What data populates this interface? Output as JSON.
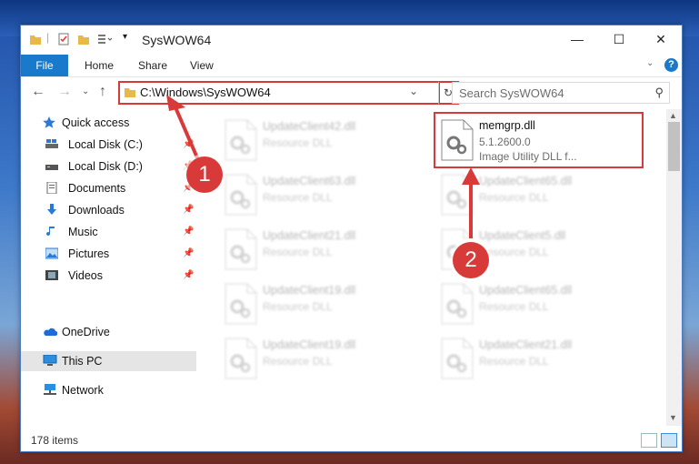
{
  "window": {
    "title": "SysWOW64",
    "controls": {
      "minimize": "—",
      "maximize": "☐",
      "close": "✕"
    }
  },
  "ribbon": {
    "tabs": [
      "File",
      "Home",
      "Share",
      "View"
    ],
    "expand": "⌄",
    "help": "?"
  },
  "address_bar": {
    "path": "C:\\Windows\\SysWOW64",
    "refresh": "↻",
    "search_placeholder": "Search SysWOW64"
  },
  "nav": {
    "back": "←",
    "forward": "→",
    "recent": "⌄",
    "up": "↑",
    "items": [
      {
        "label": "Quick access",
        "icon": "star-icon",
        "pinned": false
      },
      {
        "label": "Local Disk (C:)",
        "icon": "drive-icon",
        "pinned": true
      },
      {
        "label": "Local Disk (D:)",
        "icon": "drive-icon",
        "pinned": true
      },
      {
        "label": "Documents",
        "icon": "documents-icon",
        "pinned": true
      },
      {
        "label": "Downloads",
        "icon": "downloads-icon",
        "pinned": true
      },
      {
        "label": "Music",
        "icon": "music-icon",
        "pinned": true
      },
      {
        "label": "Pictures",
        "icon": "pictures-icon",
        "pinned": true
      },
      {
        "label": "Videos",
        "icon": "videos-icon",
        "pinned": true
      },
      {
        "label": "OneDrive",
        "icon": "onedrive-icon",
        "pinned": false
      },
      {
        "label": "This PC",
        "icon": "pc-icon",
        "pinned": false,
        "selected": true
      },
      {
        "label": "Network",
        "icon": "network-icon",
        "pinned": false
      }
    ]
  },
  "files": {
    "left": [
      {
        "name": "UpdateClient42.dll",
        "type": "Resource DLL"
      },
      {
        "name": "UpdateClient63.dll",
        "type": "Resource DLL"
      },
      {
        "name": "UpdateClient21.dll",
        "type": "Resource DLL"
      },
      {
        "name": "UpdateClient19.dll",
        "type": "Resource DLL"
      },
      {
        "name": "UpdateClient19.dll",
        "type": "Resource DLL"
      }
    ],
    "right": [
      {
        "name": "memgrp.dll",
        "version": "5.1.2600.0",
        "description": "Image Utility DLL f..."
      },
      {
        "name": "UpdateClient65.dll",
        "type": "Resource DLL"
      },
      {
        "name": "UpdateClient5.dll",
        "type": "Resource DLL"
      },
      {
        "name": "UpdateClient65.dll",
        "type": "Resource DLL"
      },
      {
        "name": "UpdateClient21.dll",
        "type": "Resource DLL"
      }
    ]
  },
  "status": {
    "count": "178 items"
  },
  "callouts": [
    "1",
    "2"
  ],
  "colors": {
    "accent": "#1979ca",
    "highlight": "#d83a3a"
  }
}
